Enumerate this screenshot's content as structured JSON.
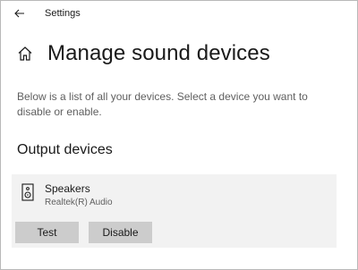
{
  "titlebar": {
    "back_icon": "back-arrow-icon",
    "app_title": "Settings"
  },
  "header": {
    "home_icon": "home-icon",
    "title": "Manage sound devices"
  },
  "description": "Below is a list of all your devices. Select a device you want to disable or enable.",
  "output_devices": {
    "section_title": "Output devices",
    "devices": [
      {
        "icon": "speaker-icon",
        "name": "Speakers",
        "driver": "Realtek(R) Audio",
        "test_label": "Test",
        "disable_label": "Disable"
      }
    ]
  },
  "colors": {
    "card_background": "#f2f2f2",
    "button_background": "#cccccc",
    "secondary_text": "#5f5f5f"
  }
}
